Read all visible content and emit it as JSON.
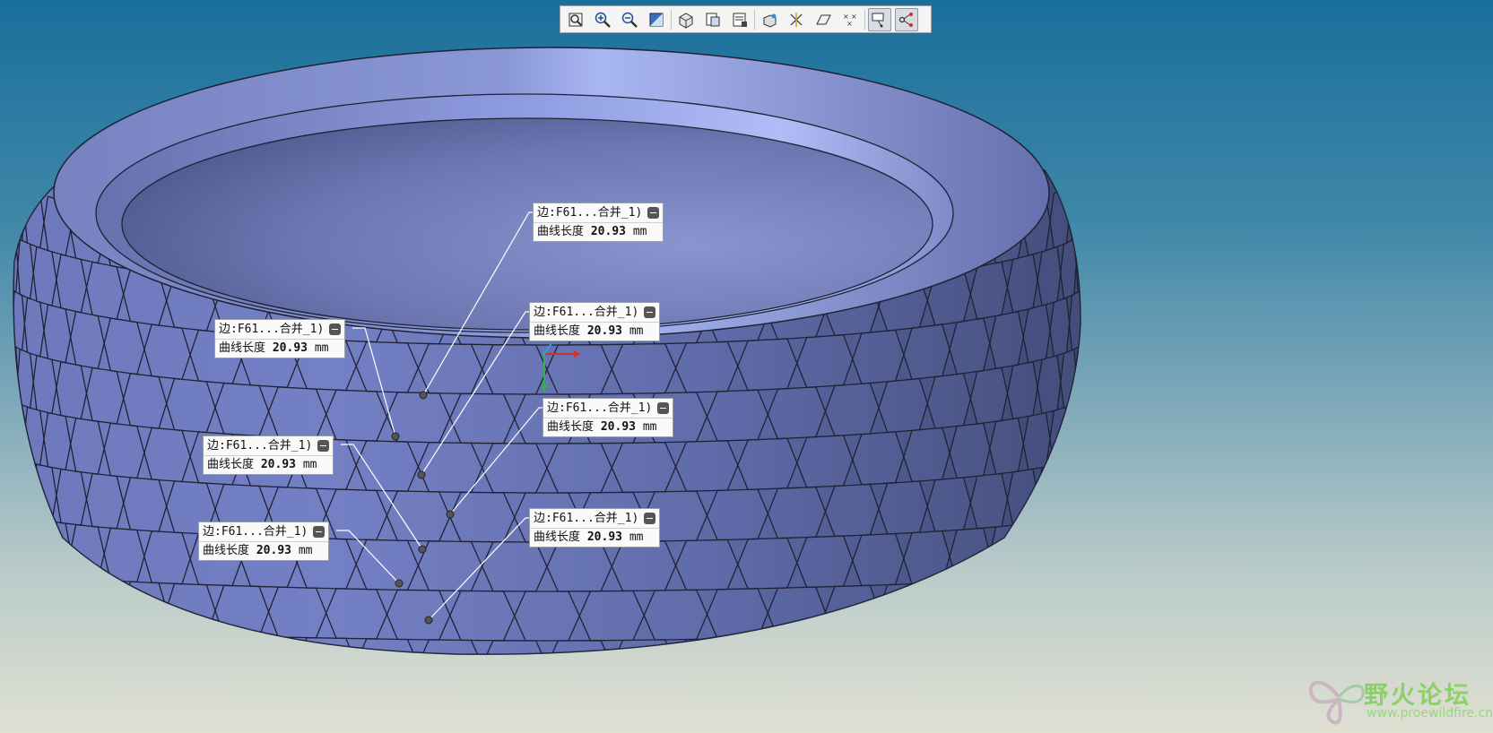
{
  "toolbar": {
    "buttons": [
      {
        "icon": "zoom-fit-icon"
      },
      {
        "icon": "zoom-in-icon"
      },
      {
        "icon": "zoom-out-icon"
      },
      {
        "icon": "repaint-icon"
      },
      {
        "icon": "display-style-icon"
      },
      {
        "icon": "saved-views-icon"
      },
      {
        "icon": "view-manager-icon"
      },
      {
        "icon": "perspective-icon"
      },
      {
        "icon": "datum-display-icon"
      },
      {
        "icon": "plane-display-icon"
      },
      {
        "icon": "point-display-icon"
      },
      {
        "icon": "annotation-display-icon",
        "active": true
      },
      {
        "icon": "spin-center-icon",
        "active": true
      }
    ]
  },
  "annotations": [
    {
      "edge_label": "边:F61...合并_1)",
      "measure_label": "曲线长度",
      "value": "20.93",
      "unit": "mm"
    },
    {
      "edge_label": "边:F61...合并_1)",
      "measure_label": "曲线长度",
      "value": "20.93",
      "unit": "mm"
    },
    {
      "edge_label": "边:F61...合并_1)",
      "measure_label": "曲线长度",
      "value": "20.93",
      "unit": "mm"
    },
    {
      "edge_label": "边:F61...合并_1)",
      "measure_label": "曲线长度",
      "value": "20.93",
      "unit": "mm"
    },
    {
      "edge_label": "边:F61...合并_1)",
      "measure_label": "曲线长度",
      "value": "20.93",
      "unit": "mm"
    },
    {
      "edge_label": "边:F61...合并_1)",
      "measure_label": "曲线长度",
      "value": "20.93",
      "unit": "mm"
    },
    {
      "edge_label": "边:F61...合并_1)",
      "measure_label": "曲线长度",
      "value": "20.93",
      "unit": "mm"
    }
  ],
  "watermark": {
    "title": "野火论坛",
    "url": "www.proewildfire.cn"
  },
  "colors": {
    "background_top": "#1a6f9b",
    "background_bottom": "#e0e0d2",
    "model_face": "#6e7ab8",
    "model_rim": "#7b86c2",
    "model_edge": "#1f2235",
    "leader_line": "#ffffff"
  }
}
